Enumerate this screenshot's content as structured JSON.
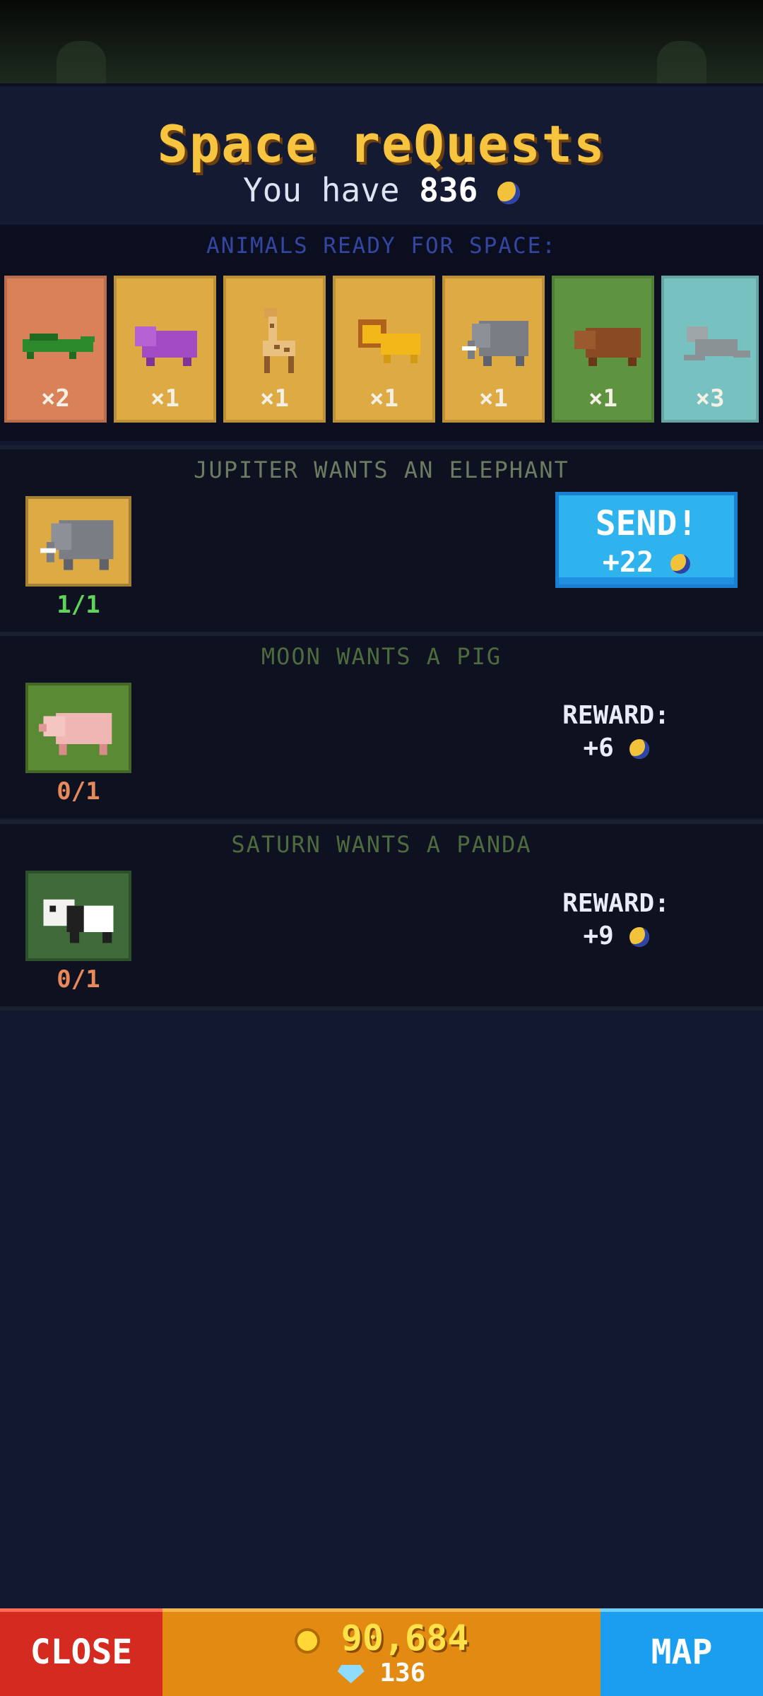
{
  "header": {
    "title": "Space reQuests",
    "balance_prefix": "You have",
    "balance_value": "836"
  },
  "animals_section": {
    "label": "ANIMALS READY FOR SPACE:",
    "cards": [
      {
        "animal": "crocodile-icon",
        "count": "×2",
        "bg": "#d9825a"
      },
      {
        "animal": "hippo-icon",
        "count": "×1",
        "bg": "#ddaa44"
      },
      {
        "animal": "giraffe-icon",
        "count": "×1",
        "bg": "#ddaa44"
      },
      {
        "animal": "lion-icon",
        "count": "×1",
        "bg": "#ddaa44"
      },
      {
        "animal": "elephant-icon",
        "count": "×1",
        "bg": "#ddaa44"
      },
      {
        "animal": "bear-icon",
        "count": "×1",
        "bg": "#5e9440"
      },
      {
        "animal": "seal-icon",
        "count": "×3",
        "bg": "#77c2c0"
      }
    ]
  },
  "requests": [
    {
      "title": "JUPITER WANTS AN ELEPHANT",
      "title_color": "#6f7a62",
      "animal": "elephant-icon",
      "tile_bg": "#ddaa44",
      "progress": "1/1",
      "progress_color": "#5fd35a",
      "send_label": "SEND!",
      "send_reward": "+22"
    },
    {
      "title": "MOON WANTS A PIG",
      "title_color": "#4d6b3f",
      "animal": "pig-icon",
      "tile_bg": "#5b8a34",
      "progress": "0/1",
      "progress_color": "#e8895a",
      "reward_label": "REWARD:",
      "reward_value": "+6"
    },
    {
      "title": "SATURN WANTS A PANDA",
      "title_color": "#4d6b3f",
      "animal": "panda-icon",
      "tile_bg": "#3e6a3a",
      "progress": "0/1",
      "progress_color": "#e8895a",
      "reward_label": "REWARD:",
      "reward_value": "+9"
    }
  ],
  "bottom_bar": {
    "close_label": "CLOSE",
    "coins": "90,684",
    "gems": "136",
    "map_label": "MAP"
  }
}
